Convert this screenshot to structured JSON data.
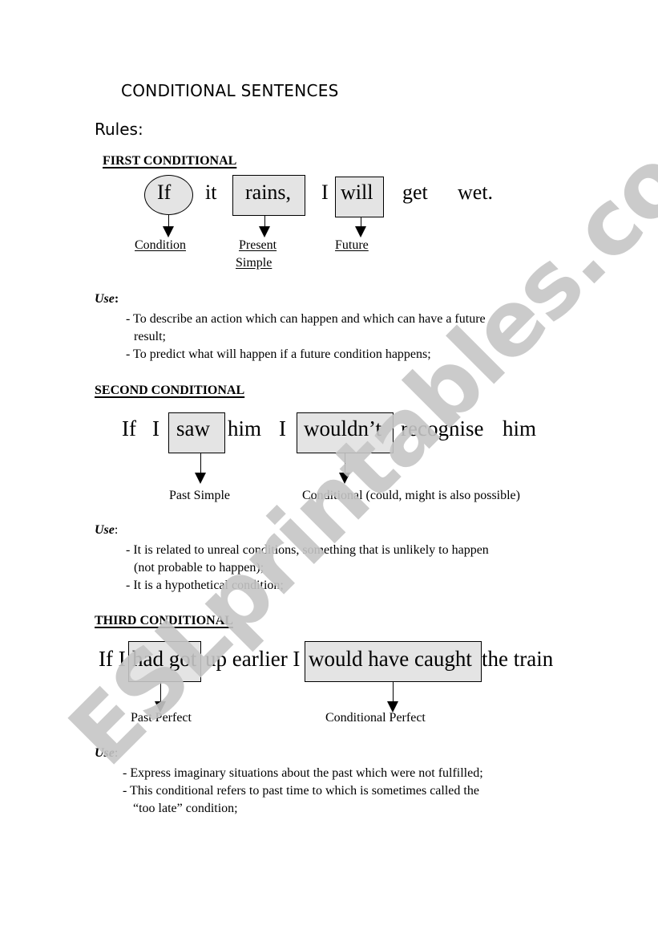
{
  "title": "CONDITIONAL SENTENCES",
  "rules_label": "Rules:",
  "watermark": "ESLprintables.com",
  "first": {
    "heading": "FIRST CONDITIONAL",
    "sentence": {
      "if": "If",
      "it": "it",
      "rains": "rains,",
      "i": "I",
      "will": "will",
      "get": "get",
      "wet": "wet."
    },
    "labels": {
      "condition": "Condition",
      "present": "Present",
      "simple": "Simple",
      "future": "Future"
    },
    "use_label": "Use",
    "use_colon": ":",
    "uses": [
      "- To describe an action which can happen and which can have a future",
      "result;",
      "- To predict what will happen if a future condition happens;"
    ]
  },
  "second": {
    "heading": "SECOND CONDITIONAL",
    "sentence": {
      "if": "If",
      "i1": "I",
      "saw": "saw",
      "him1": "him",
      "i2": "I",
      "wouldnt": "wouldn’t",
      "recognise": "recognise",
      "him2": "him"
    },
    "labels": {
      "past_simple": "Past Simple",
      "conditional": "Conditional (could, might is also possible)"
    },
    "use_label": "Use",
    "use_colon": ":",
    "uses": [
      "- It is related to unreal conditions, something that is unlikely to happen",
      "(not probable to happen);",
      "- It is a hypothetical condition;"
    ]
  },
  "third": {
    "heading": "THIRD CONDITIONAL",
    "sentence": {
      "if_i": "If I",
      "had_got": "had got",
      "up_earlier_i": "up earlier I",
      "would_have_caught": "would have caught",
      "the_train": "the train"
    },
    "labels": {
      "past_perfect": "Past Perfect",
      "conditional_perfect": "Conditional Perfect"
    },
    "use_label": "Use",
    "use_colon": ":",
    "uses": [
      "- Express imaginary situations about the past which were not fulfilled;",
      "- This conditional refers to past time to which is sometimes called the",
      "“too late” condition;"
    ]
  }
}
